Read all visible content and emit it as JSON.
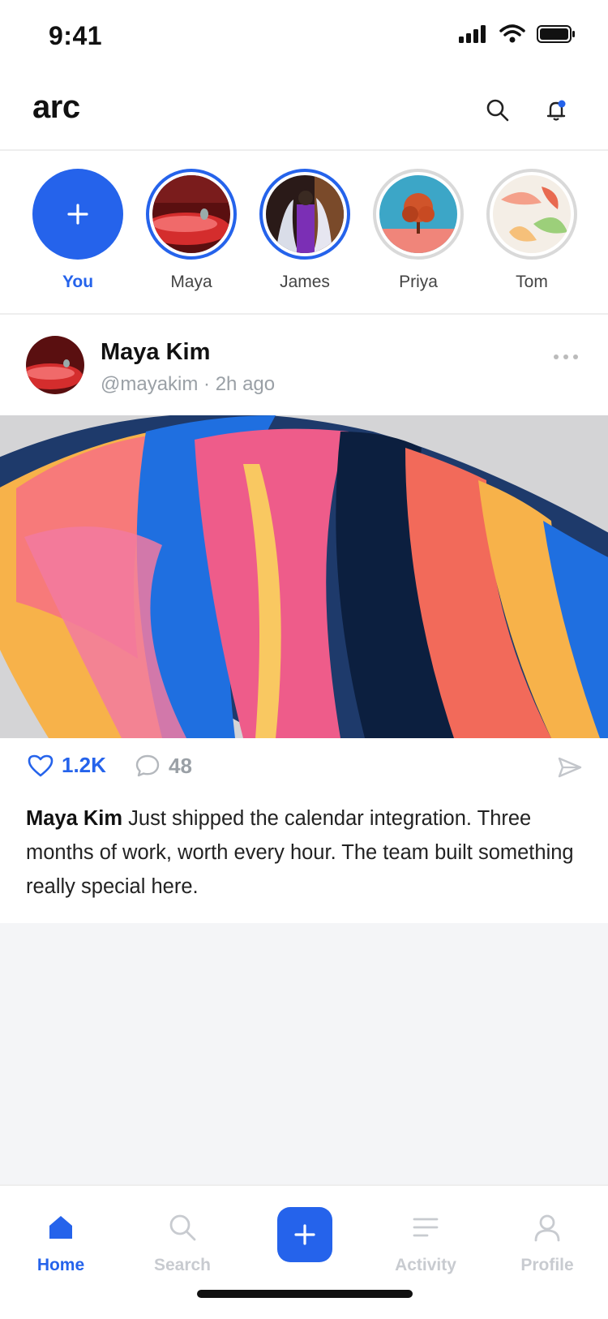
{
  "status": {
    "time": "9:41"
  },
  "header": {
    "brand": "arc"
  },
  "stories": [
    {
      "name": "You",
      "state": "add"
    },
    {
      "name": "Maya",
      "state": "active"
    },
    {
      "name": "James",
      "state": "active"
    },
    {
      "name": "Priya",
      "state": "seen"
    },
    {
      "name": "Tom",
      "state": "seen"
    }
  ],
  "post": {
    "author": "Maya Kim",
    "meta": "@mayakim · 2h ago",
    "likes": "1.2K",
    "comments": "48",
    "caption_author": "Maya Kim",
    "caption_text": "Just shipped the calendar integration. Three months of work, worth every hour. The team built something really special here."
  },
  "tabs": [
    {
      "label": "Home",
      "icon": "home-icon",
      "active": true
    },
    {
      "label": "Search",
      "icon": "search-icon"
    },
    {
      "label": "",
      "icon": "plus-icon"
    },
    {
      "label": "Activity",
      "icon": "activity-icon"
    },
    {
      "label": "Profile",
      "icon": "profile-icon"
    }
  ],
  "colors": {
    "accent": "#2563eb",
    "muted": "#9aa0a6"
  }
}
